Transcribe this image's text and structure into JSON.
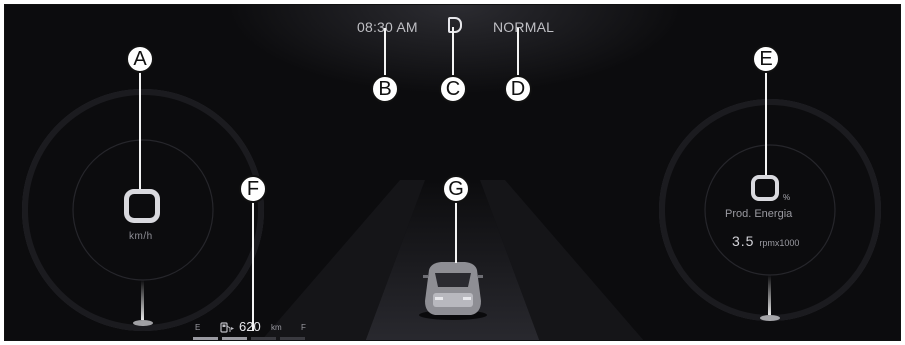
{
  "status_bar": {
    "clock": "08:30 AM",
    "drive_mode": "NORMAL",
    "gear_icon": "gear-indicator-icon"
  },
  "speedometer": {
    "unit": "km/h",
    "icon": "speed-digit-placeholder"
  },
  "power_meter": {
    "percent_unit": "%",
    "label": "Prod. Energia",
    "rpm_value": "3.5",
    "rpm_unit": "rpmx1000"
  },
  "fuel_gauge": {
    "empty_label": "E",
    "full_label": "F",
    "range_value": "620",
    "range_unit": "km",
    "icon": "fuel-pump-icon",
    "level_fraction": 0.5
  },
  "callouts": {
    "a": "A",
    "b": "B",
    "c": "C",
    "d": "D",
    "e": "E",
    "f": "F",
    "g": "G"
  },
  "colors": {
    "background": "#0c0c0e",
    "text_primary": "#e8e8ec",
    "text_secondary": "#8f8f96"
  }
}
